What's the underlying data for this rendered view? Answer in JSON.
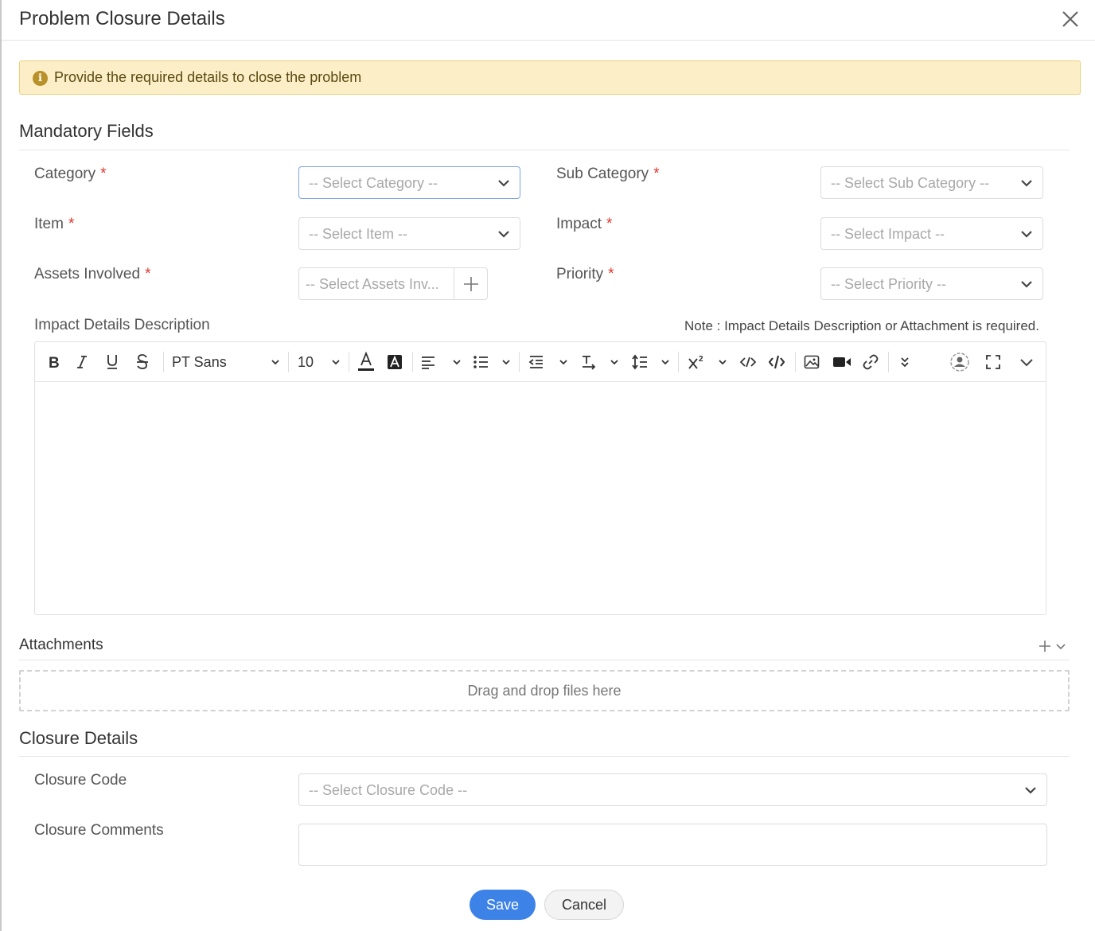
{
  "dialog": {
    "title": "Problem Closure Details"
  },
  "banner": {
    "text": "Provide the required details to close the problem",
    "icon": "info-icon",
    "icon_glyph": "i"
  },
  "mandatory": {
    "title": "Mandatory Fields",
    "required_marker": "*",
    "category": {
      "label": "Category",
      "placeholder": "-- Select Category --"
    },
    "sub_category": {
      "label": "Sub Category",
      "placeholder": "-- Select Sub Category --"
    },
    "item": {
      "label": "Item",
      "placeholder": "-- Select Item --"
    },
    "impact": {
      "label": "Impact",
      "placeholder": "-- Select Impact --"
    },
    "assets": {
      "label": "Assets Involved",
      "placeholder": "-- Select Assets Inv..."
    },
    "priority": {
      "label": "Priority",
      "placeholder": "-- Select Priority --"
    },
    "impact_desc": {
      "label": "Impact Details Description",
      "note": "Note : Impact Details Description or Attachment is required.",
      "font_family": "PT Sans",
      "font_size": "10"
    }
  },
  "attachments": {
    "title": "Attachments",
    "dropzone_text": "Drag and drop files here"
  },
  "closure": {
    "title": "Closure Details",
    "code": {
      "label": "Closure Code",
      "placeholder": "-- Select Closure Code --"
    },
    "comments": {
      "label": "Closure Comments"
    }
  },
  "actions": {
    "save": "Save",
    "cancel": "Cancel"
  },
  "colors": {
    "primary": "#3d82e6",
    "required": "#e0362c",
    "banner_bg": "#fcefc7"
  }
}
